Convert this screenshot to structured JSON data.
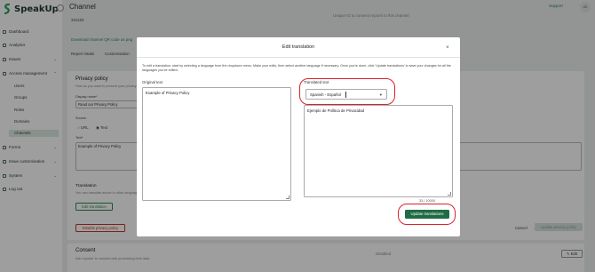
{
  "app": {
    "brand": "SpeakUp",
    "page_title": "Channel",
    "support_label": "Support",
    "avatar_initials": "JD"
  },
  "sidebar": {
    "items": [
      {
        "label": "Dashboard"
      },
      {
        "label": "Analytics"
      },
      {
        "label": "Issues"
      },
      {
        "label": "Access management"
      },
      {
        "label": "Forms"
      },
      {
        "label": "Issue customisation"
      },
      {
        "label": "System"
      },
      {
        "label": "Log out"
      }
    ],
    "sub_items": [
      {
        "label": "Users"
      },
      {
        "label": "Groups"
      },
      {
        "label": "Roles"
      },
      {
        "label": "Domains"
      },
      {
        "label": "Channels"
      }
    ]
  },
  "background": {
    "channel_code": "331153",
    "unique_id_note": "Unique ID to connect reports to this channel",
    "download_link": "Download channel QR code as png",
    "tabs": [
      "Report Intake",
      "Customisation"
    ],
    "privacy_heading": "Privacy policy",
    "privacy_sub": "How do you want to present your privacy policy?",
    "display_name_label": "Display name*",
    "display_name_value": "Read our Privacy Policy",
    "source_label": "Source",
    "source_option_url": "URL",
    "source_option_text": "Text",
    "text_label": "Text*",
    "text_value": "Example of Privacy Policy",
    "translation_heading": "Translation",
    "translation_sub": "You can translate above in other languages.",
    "edit_translation_btn": "Edit translation",
    "disable_privacy_btn": "Disable privacy policy",
    "cancel_btn": "Cancel",
    "update_privacy_btn": "Update privacy policy",
    "consent_heading": "Consent",
    "consent_sub": "Ask reporter to consent with processing their data",
    "consent_status": "Disabled",
    "edit_btn": "Edit"
  },
  "modal": {
    "title": "Edit translation",
    "instructions": "To edit a translation, start by selecting a language from the dropdown menu. Make your edits, then select another language if necessary. Once you're done, click 'Update translations' to save your changes for all the languages you've edited.",
    "original_label": "Original text",
    "original_value": "Example of Privacy Policy",
    "translated_label": "Translated text",
    "language_selected": "Spanish - Español",
    "translated_value": "Ejemplo de Política de Privacidad",
    "counter": "33 / 10000",
    "update_button": "Update translations"
  },
  "colors": {
    "brand_green": "#1f6b45",
    "highlight_red": "#d9232b"
  }
}
